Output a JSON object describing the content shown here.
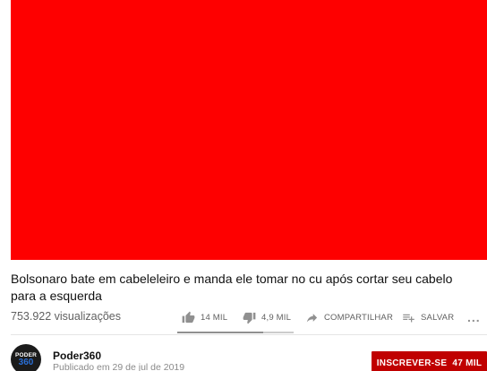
{
  "video": {
    "title": "Bolsonaro bate em cabeleleiro e manda ele tomar no cu após cortar seu cabelo para a esquerda",
    "views": "753.922 visualizações",
    "player_color": "#fe0000"
  },
  "actions": {
    "like_count": "14 MIL",
    "dislike_count": "4,9 MIL",
    "share_label": "COMPARTILHAR",
    "save_label": "SALVAR",
    "more_label": "..."
  },
  "sentiment": {
    "like_fraction": 0.74
  },
  "channel": {
    "name": "Poder360",
    "published": "Publicado em 29 de jul de 2019",
    "avatar_text_top": "PODER",
    "avatar_text_bottom": "360"
  },
  "subscribe": {
    "label": "INSCREVER-SE",
    "count": "47 MIL",
    "color": "#c00000"
  },
  "icons": {
    "like": "thumbs-up-icon",
    "dislike": "thumbs-down-icon",
    "share": "share-arrow-icon",
    "save": "playlist-add-icon",
    "more": "more-horizontal-icon"
  }
}
